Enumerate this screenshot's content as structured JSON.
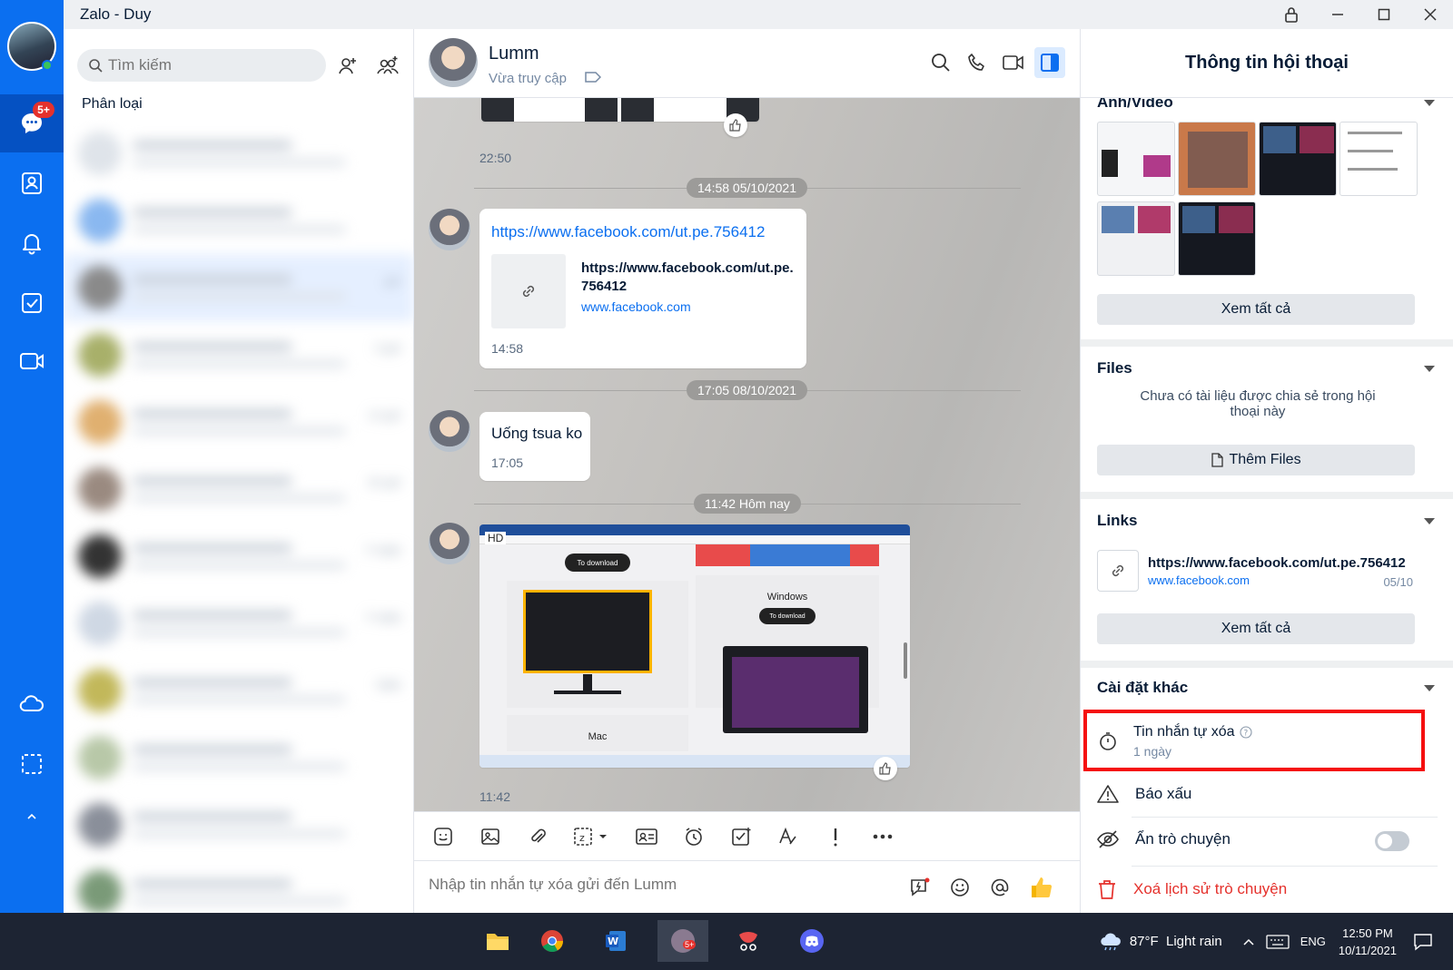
{
  "window": {
    "title": "Zalo - Duy"
  },
  "nav": {
    "badge": "5+"
  },
  "search": {
    "placeholder": "Tìm kiếm"
  },
  "list": {
    "filter_label": "Phân loại",
    "times": [
      "",
      "",
      "giờ",
      "3 giờ",
      "14 giờ",
      "20 giờ",
      "2 ngày",
      "2 ngày",
      "ngày",
      "",
      ""
    ]
  },
  "chat": {
    "contact_name": "Lumm",
    "status": "Vừa truy cập",
    "messages": {
      "m0_time": "22:50",
      "d1": "14:58 05/10/2021",
      "link_url": "https://www.facebook.com/ut.pe.756412",
      "link_card_title": "https://www.facebook.com/ut.pe.756412",
      "link_card_domain": "www.facebook.com",
      "m1_time": "14:58",
      "d2": "17:05 08/10/2021",
      "m2_text": "Uống tsua ko",
      "m2_time": "17:05",
      "d3": "11:42 Hôm nay",
      "img_hd": "HD",
      "img_windows": "Windows",
      "img_download": "To download",
      "img_mac": "Mac",
      "m3_time": "11:42"
    },
    "input_placeholder": "Nhập tin nhắn tự xóa gửi đến Lumm"
  },
  "panel": {
    "title": "Thông tin hội thoại",
    "media_title": "Ảnh/Video",
    "see_all": "Xem tất cả",
    "files_title": "Files",
    "files_empty": "Chưa có tài liệu được chia sẻ trong hội thoại này",
    "add_files": "Thêm Files",
    "links_title": "Links",
    "link_url": "https://www.facebook.com/ut.pe.756412",
    "link_domain": "www.facebook.com",
    "link_date": "05/10",
    "links_see_all": "Xem tất cả",
    "other_title": "Cài đặt khác",
    "auto_delete_label": "Tin nhắn tự xóa",
    "auto_delete_value": "1 ngày",
    "report_label": "Báo xấu",
    "hide_label": "Ẩn trò chuyện",
    "delete_history_label": "Xoá lịch sử trò chuyện"
  },
  "taskbar": {
    "weather": "87°F  Light rain",
    "lang": "ENG",
    "time": "12:50 PM",
    "date": "10/11/2021",
    "zalo_badge": "5+"
  },
  "colors": {
    "accent": "#0b6ff0",
    "danger": "#e5312c",
    "highlight": "#f50f0f"
  }
}
